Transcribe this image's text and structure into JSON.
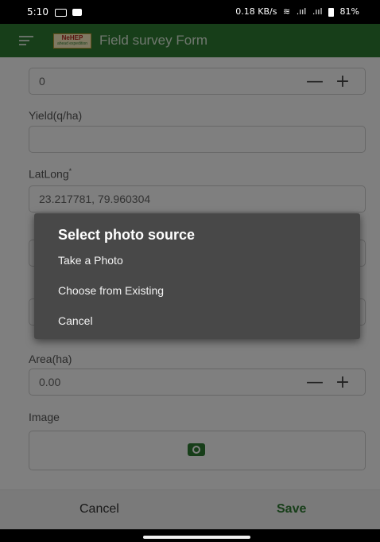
{
  "status_bar": {
    "time": "5:10",
    "network_speed": "0.18 KB/s",
    "signal_1": ".ııl",
    "signal_2": ".ııl",
    "battery": "81%"
  },
  "app_bar": {
    "logo_text": "NeHEP",
    "logo_subtext": "ahead expedition",
    "title": "Field survey Form"
  },
  "form": {
    "top_field_value": "0",
    "yield_label": "Yield(q/ha)",
    "yield_value": "",
    "latlong_label": "LatLong",
    "latlong_required": "*",
    "latlong_value": "23.217781, 79.960304",
    "area_label": "Area(ha)",
    "area_value": "0.00",
    "image_label": "Image",
    "minus": "—",
    "plus": "+"
  },
  "dialog": {
    "title": "Select photo source",
    "options": [
      "Take a Photo",
      "Choose from Existing",
      "Cancel"
    ]
  },
  "actions": {
    "cancel_label": "Cancel",
    "save_label": "Save"
  },
  "colors": {
    "primary": "#2e7d32",
    "dialog_bg": "#484848"
  }
}
